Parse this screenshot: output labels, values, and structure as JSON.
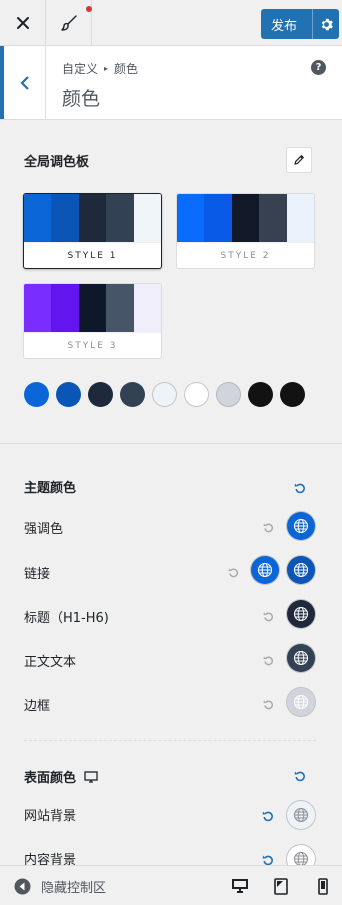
{
  "header": {
    "publish_label": "发布"
  },
  "section": {
    "breadcrumb_root": "自定义",
    "title": "颜色"
  },
  "palette": {
    "label": "全局调色板",
    "styles": [
      {
        "caption": "STYLE 1",
        "selected": true,
        "colors": [
          "#0a66d6",
          "#0a55b5",
          "#1e293b",
          "#334155",
          "#f0f5fa"
        ]
      },
      {
        "caption": "STYLE 2",
        "selected": false,
        "colors": [
          "#0a6cff",
          "#0a5ae8",
          "#111827",
          "#374151",
          "#eaf3fb"
        ]
      },
      {
        "caption": "STYLE 3",
        "selected": false,
        "colors": [
          "#7b2cff",
          "#6315f0",
          "#0f172a",
          "#475569",
          "#f1eefc"
        ]
      }
    ],
    "swatches": [
      "#0a66d6",
      "#0a55b5",
      "#1e293b",
      "#334155",
      "#eef3f8",
      "#ffffff",
      "#d1d5db",
      "#121212",
      "#121212"
    ]
  },
  "theme_colors": {
    "label": "主题颜色",
    "rows": [
      {
        "label": "强调色",
        "colors": [
          "#0a66d6"
        ]
      },
      {
        "label": "链接",
        "colors": [
          "#0a66d6",
          "#0a55b5"
        ]
      },
      {
        "label": "标题（H1-H6)",
        "colors": [
          "#1e293b"
        ]
      },
      {
        "label": "正文文本",
        "colors": [
          "#334155"
        ]
      },
      {
        "label": "边框",
        "colors": [
          "#d1d5db"
        ]
      }
    ]
  },
  "surface_colors": {
    "label": "表面颜色",
    "rows": [
      {
        "label": "网站背景",
        "colors": [
          "#eef3f8"
        ]
      },
      {
        "label": "内容背景",
        "colors": [
          "#ffffff"
        ]
      }
    ]
  },
  "footer": {
    "hide_label": "隐藏控制区"
  }
}
